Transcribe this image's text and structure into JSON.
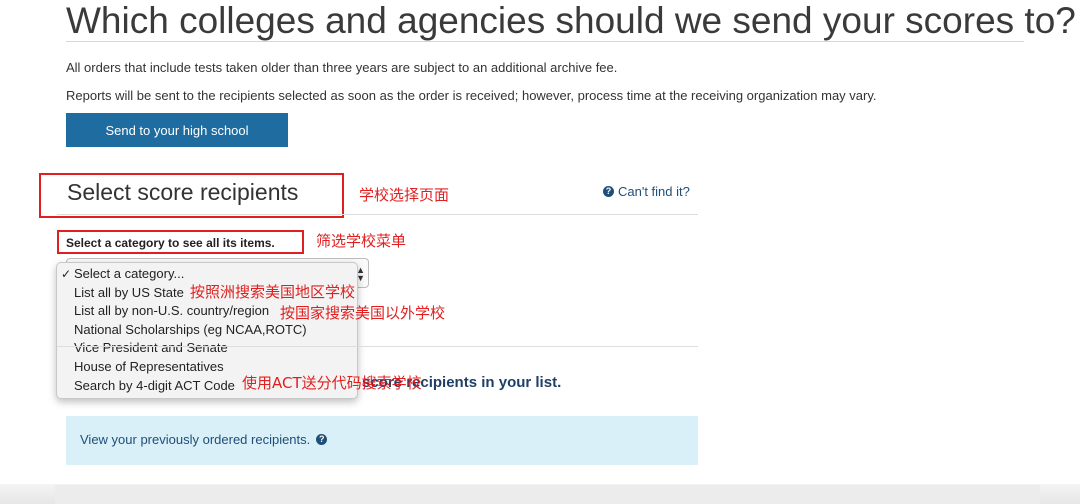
{
  "header": {
    "title": "Which colleges and agencies should we send your scores to?",
    "note_archive": "All orders that include tests taken older than three years are subject to an additional archive fee.",
    "note_process": "Reports will be sent to the recipients selected as soon as the order is received; however, process time at the receiving organization may vary.",
    "high_school_button": "Send to your high school"
  },
  "recipients": {
    "section_title": "Select score recipients",
    "cant_find_link": "Can't find it?",
    "category_label": "Select a category to see all its items.",
    "dropdown": {
      "selected": "Select a category...",
      "options": [
        "Select a category...",
        "List all by US State",
        "List all by non-U.S. country/region",
        "National Scholarships (eg NCAA,ROTC)",
        "Vice President and Senate",
        "House of Representatives",
        "Search by 4-digit ACT Code"
      ]
    },
    "list_text": "score recipients in your list.",
    "previous_link": "View your previously ordered recipients."
  },
  "annotations": {
    "recipients_page": "学校选择页面",
    "filter_menu": "筛选学校菜单",
    "by_state": "按照洲搜索美国地区学校",
    "by_country": "按国家搜索美国以外学校",
    "by_code": "使用ACT送分代码搜索学校"
  },
  "colors": {
    "button_blue": "#1e6ca0",
    "annotation_red": "#e02020",
    "info_panel_bg": "#d9f0f8",
    "link_blue": "#1f4e79"
  },
  "icons": {
    "help": "question-circle-icon",
    "select_arrows": "updown-arrows-icon",
    "checkmark": "checkmark-icon"
  }
}
